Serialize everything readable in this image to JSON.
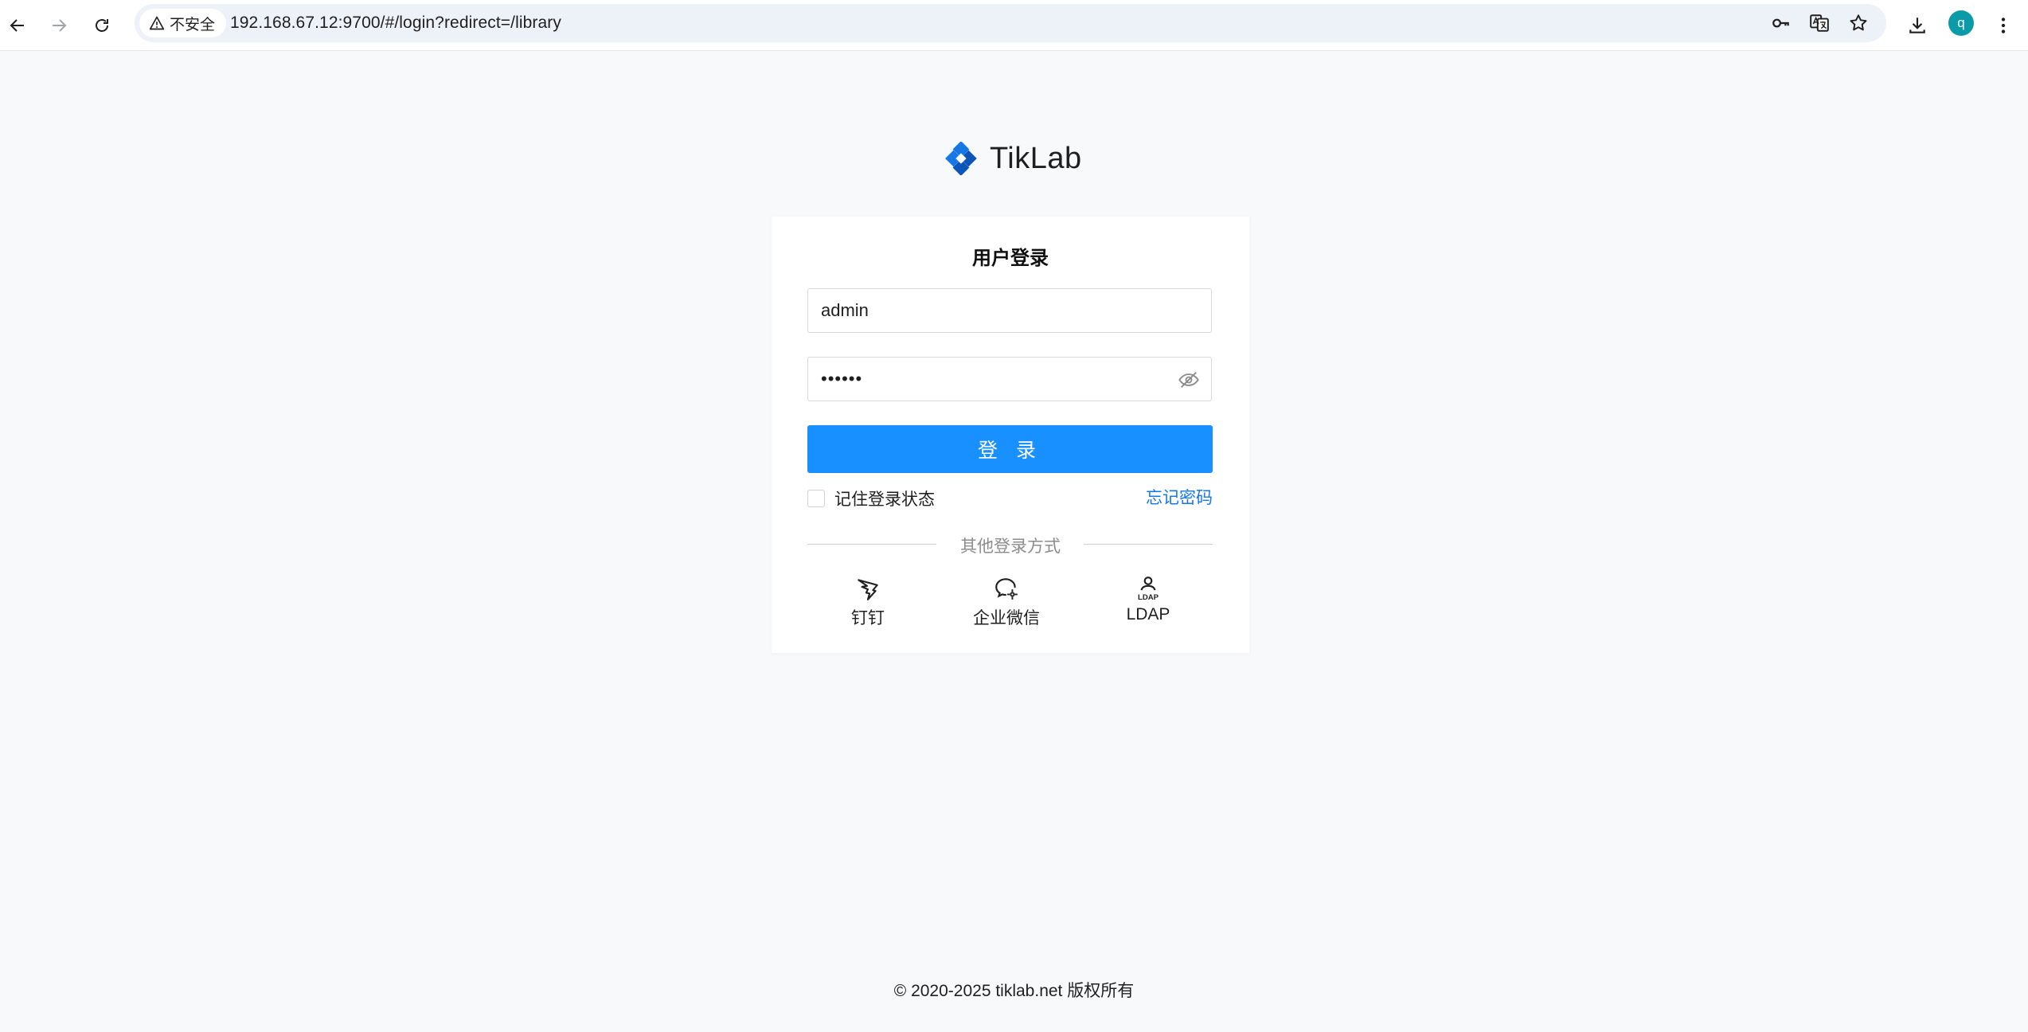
{
  "browser": {
    "security_label": "不安全",
    "url": "192.168.67.12:9700/#/login?redirect=/library",
    "profile_initial": "q"
  },
  "brand": {
    "name": "TikLab",
    "accent": "#1677e6"
  },
  "login": {
    "title": "用户登录",
    "username": "admin",
    "password": "••••••",
    "submit_label": "登 录",
    "remember_label": "记住登录状态",
    "forgot_label": "忘记密码",
    "divider_text": "其他登录方式",
    "button_color": "#1890ff"
  },
  "alternatives": [
    {
      "label": "钉钉",
      "icon": "dingtalk-icon"
    },
    {
      "label": "企业微信",
      "icon": "wecom-icon"
    },
    {
      "label": "LDAP",
      "icon": "ldap-icon"
    }
  ],
  "footer": {
    "copyright": "© 2020-2025 tiklab.net 版权所有"
  }
}
